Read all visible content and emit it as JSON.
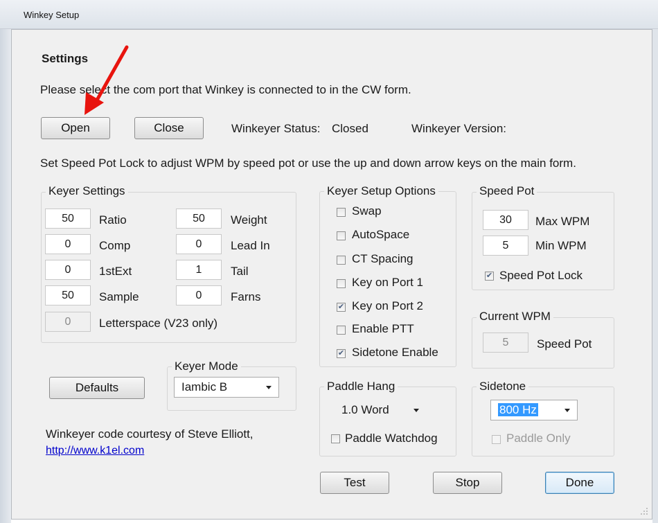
{
  "window": {
    "title": "Winkey Setup"
  },
  "settings": {
    "heading": "Settings",
    "instruction": "Please select the com port that Winkey is connected to in the CW form.",
    "open_label": "Open",
    "close_label": "Close",
    "status_label": "Winkeyer Status:",
    "status_value": "Closed",
    "version_label": "Winkeyer Version:",
    "speed_pot_note": "Set Speed Pot Lock to adjust WPM by speed pot or use the up and down arrow keys on the main form."
  },
  "keyer_settings": {
    "label": "Keyer Settings",
    "ratio": {
      "value": "50",
      "label": "Ratio"
    },
    "comp": {
      "value": "0",
      "label": "Comp"
    },
    "first_ext": {
      "value": "0",
      "label": "1stExt"
    },
    "sample": {
      "value": "50",
      "label": "Sample"
    },
    "weight": {
      "value": "50",
      "label": "Weight"
    },
    "lead_in": {
      "value": "0",
      "label": "Lead In"
    },
    "tail": {
      "value": "1",
      "label": "Tail"
    },
    "farns": {
      "value": "0",
      "label": "Farns"
    },
    "letterspace": {
      "value": "0",
      "label": "Letterspace (V23 only)"
    }
  },
  "keyer_mode": {
    "label": "Keyer Mode",
    "value": "Iambic B"
  },
  "defaults_label": "Defaults",
  "credit": {
    "text": "Winkeyer code courtesy of Steve Elliott,",
    "link": "http://www.k1el.com"
  },
  "setup_options": {
    "label": "Keyer Setup Options",
    "items": [
      {
        "label": "Swap",
        "checked": false
      },
      {
        "label": "AutoSpace",
        "checked": false
      },
      {
        "label": "CT Spacing",
        "checked": false
      },
      {
        "label": "Key on Port 1",
        "checked": false
      },
      {
        "label": "Key on Port 2",
        "checked": true
      },
      {
        "label": "Enable PTT",
        "checked": false
      },
      {
        "label": "Sidetone Enable",
        "checked": true
      }
    ]
  },
  "paddle_hang": {
    "label": "Paddle Hang",
    "value": "1.0 Word",
    "watchdog_label": "Paddle Watchdog"
  },
  "speed_pot": {
    "label": "Speed Pot",
    "max_value": "30",
    "max_label": "Max WPM",
    "min_value": "5",
    "min_label": "Min WPM",
    "lock_label": "Speed Pot Lock"
  },
  "current_wpm": {
    "label": "Current WPM",
    "value": "5",
    "source_label": "Speed Pot"
  },
  "sidetone": {
    "label": "Sidetone",
    "value": "800 Hz",
    "paddle_only_label": "Paddle Only"
  },
  "buttons": {
    "test": "Test",
    "stop": "Stop",
    "done": "Done"
  },
  "colors": {
    "annotation_arrow": "#e8140e",
    "selection": "#3399ff",
    "link": "#0000cc"
  }
}
